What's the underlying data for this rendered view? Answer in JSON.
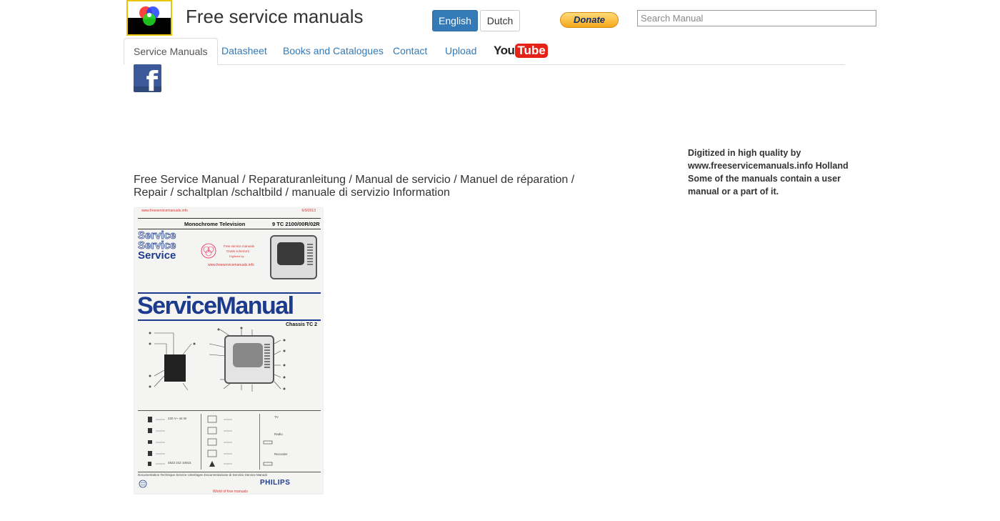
{
  "header": {
    "site_title": "Free service manuals",
    "languages": [
      {
        "label": "English",
        "active": true
      },
      {
        "label": "Dutch",
        "active": false
      }
    ],
    "donate_label": "Donate",
    "search_placeholder": "Search Manual",
    "search_value": ""
  },
  "nav": {
    "tabs": [
      {
        "label": "Service Manuals",
        "active": true
      },
      {
        "label": "Datasheet",
        "active": false
      },
      {
        "label": "Books and Catalogues",
        "active": false
      },
      {
        "label": "Contact",
        "active": false
      },
      {
        "label": "Upload",
        "active": false
      }
    ],
    "youtube_you": "You",
    "youtube_tube": "Tube"
  },
  "social": {
    "facebook_glyph": "f"
  },
  "sidebar": {
    "note_lines": [
      "Digitized in high quality by",
      "www.freeservicemanuals.info Holland",
      "Some of the manuals contain a user",
      "manual or a part of it."
    ]
  },
  "main": {
    "headline": "Free Service Manual / Reparaturanleitung / Manual de servicio / Manuel de réparation / Repair / schaltplan /schaltbild / manuale di servizio Information",
    "cover": {
      "url": "www.freeservicemanuals.info",
      "date": "6/9/2013",
      "product": "Monochrome Television",
      "model": "9 TC 2100/00R/02R",
      "service_word": "Service",
      "title": "ServiceManual",
      "chassis": "Chassis TC 2",
      "stamp_line1": "Free service manuals",
      "stamp_line2": "Gratis schema's",
      "stamp_line3": "Digitized by",
      "stamp_url": "www.freeservicemanuals.info",
      "spec_power": "220 V~ 44 W",
      "spec_tv": "TV",
      "spec_radio": "Radio",
      "spec_recorder": "Recorder",
      "part_number": "4822 242 10015",
      "footer_text": "Documentation Technique Service Unterlagen Documentazione di Servizio Service Manual",
      "philips": "PHILIPS",
      "world": "World of free manuals"
    }
  },
  "colors": {
    "primary": "#337ab7",
    "link": "#337ab7",
    "facebook": "#3b5998",
    "youtube": "#e62117",
    "donate": "#f6a71b",
    "manual_blue": "#1d3b8c"
  }
}
